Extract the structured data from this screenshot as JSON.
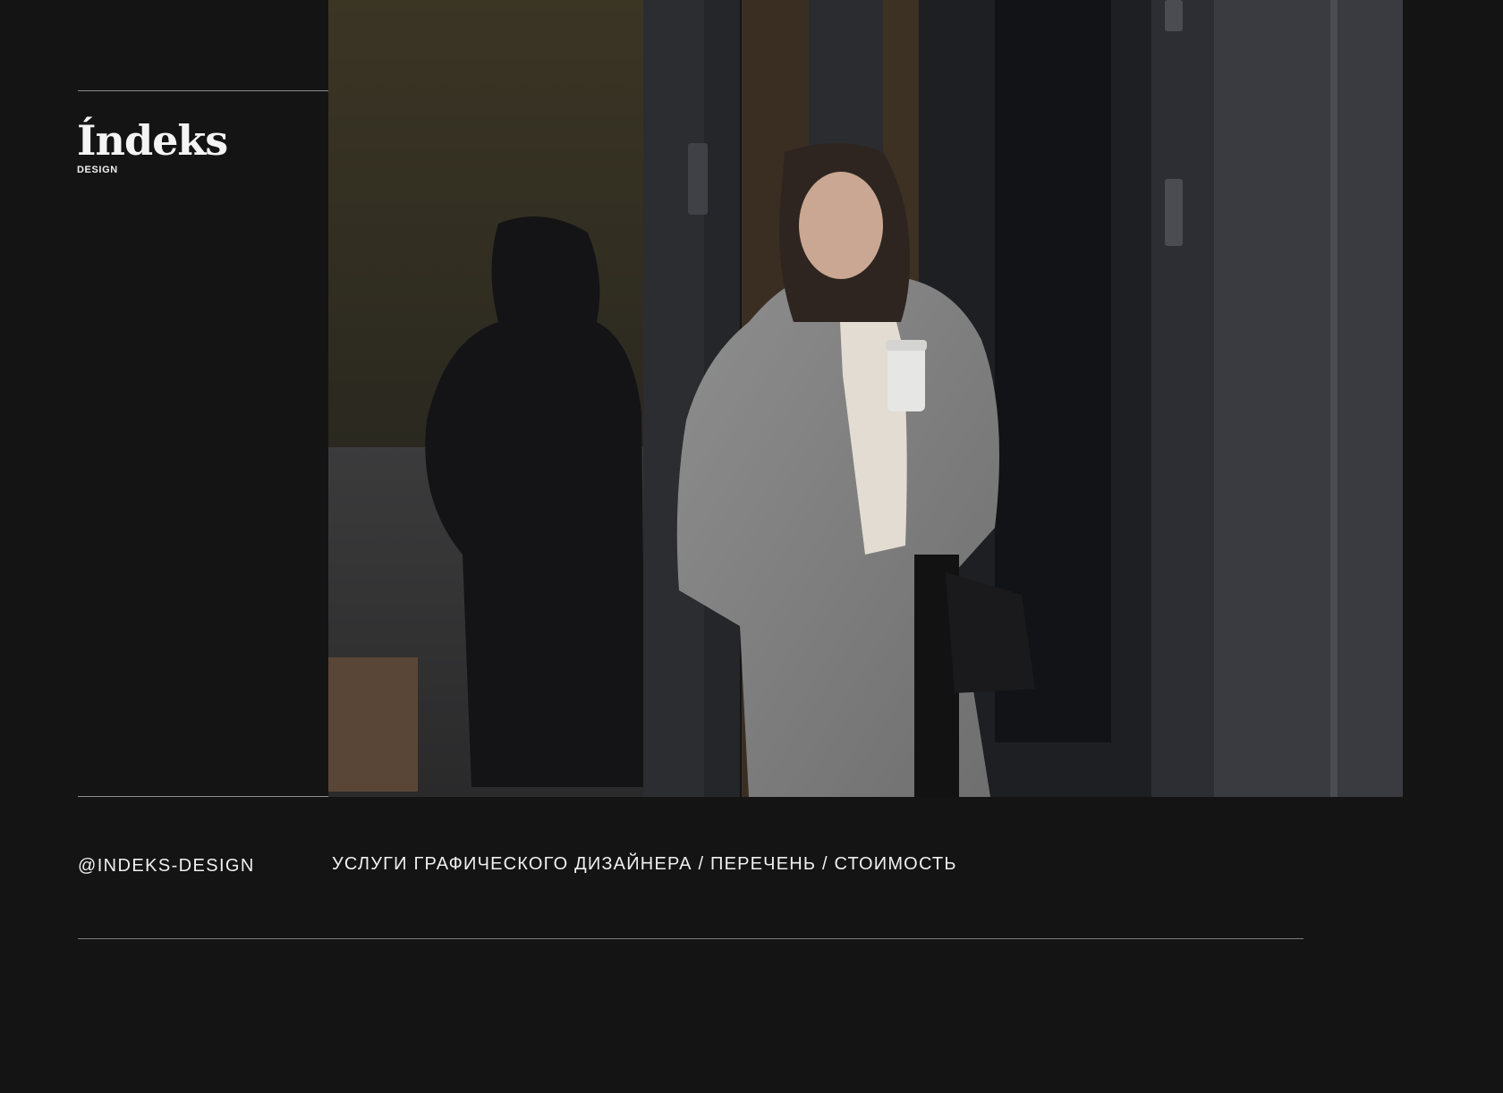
{
  "brand": {
    "logo_word": "Índeks",
    "logo_sub": "DESIGN"
  },
  "footer": {
    "handle": "@INDEKS-DESIGN",
    "tagline": "УСЛУГИ ГРАФИЧЕСКОГО ДИЗАЙНЕРА / ПЕРЕЧЕНЬ / СТОИМОСТЬ"
  },
  "hero_photo": {
    "subject": "woman-in-grey-coat-with-coffee-cup"
  },
  "colors": {
    "background": "#141414",
    "text": "#f0f0f0",
    "rule": "#8d8d8d"
  }
}
